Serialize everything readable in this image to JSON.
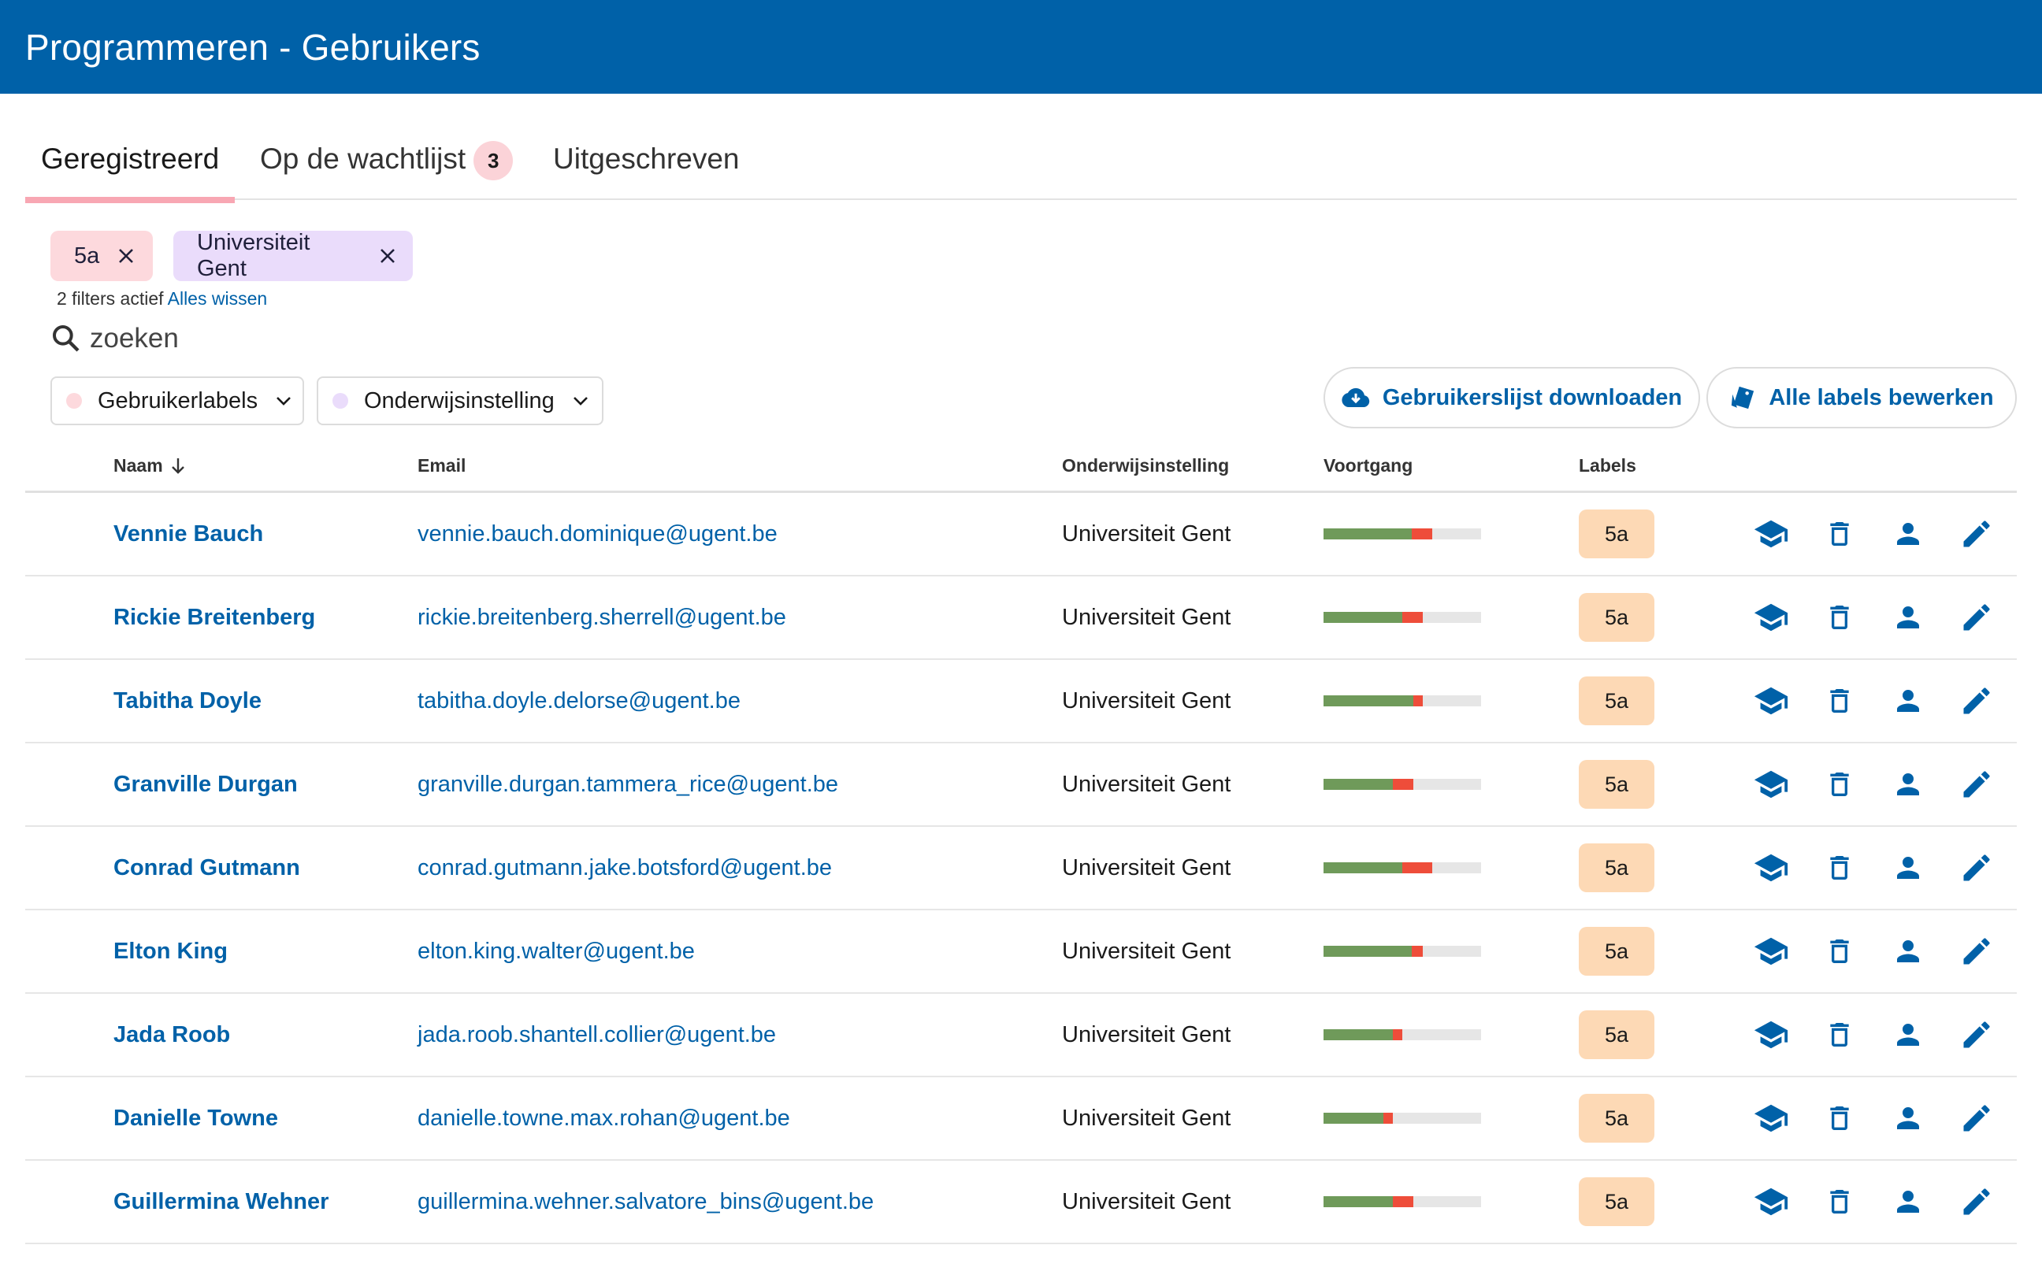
{
  "app": {
    "title": "Programmeren - Gebruikers"
  },
  "tabs": [
    {
      "label": "Geregistreerd",
      "active": true
    },
    {
      "label": "Op de wachtlijst",
      "badge": "3"
    },
    {
      "label": "Uitgeschreven"
    }
  ],
  "chips": [
    {
      "label": "5a",
      "color": "#fdd9dd"
    },
    {
      "label": "Universiteit Gent",
      "color": "#eadcfb"
    }
  ],
  "filter_info": {
    "text": "2 filters actief",
    "clear_label": "Alles wissen"
  },
  "search": {
    "placeholder": "zoeken",
    "value": ""
  },
  "dropdowns": [
    {
      "label": "Gebruikerlabels",
      "dot_color": "#fdd9dd"
    },
    {
      "label": "Onderwijsinstelling",
      "dot_color": "#eadcfb"
    }
  ],
  "buttons": {
    "download_label": "Gebruikerslijst downloaden",
    "edit_labels_label": "Alle labels bewerken"
  },
  "table": {
    "headers": {
      "name": "Naam",
      "email": "Email",
      "institution": "Onderwijsinstelling",
      "progress": "Voortgang",
      "labels": "Labels"
    },
    "sort": {
      "column": "name",
      "direction": "descending",
      "icon": "arrow-down-icon"
    },
    "rows": [
      {
        "name": "Vennie Bauch",
        "email": "vennie.bauch.dominique@ugent.be",
        "institution": "Universiteit Gent",
        "progress_ok": 0.56,
        "progress_bad": 0.13,
        "label": "5a"
      },
      {
        "name": "Rickie Breitenberg",
        "email": "rickie.breitenberg.sherrell@ugent.be",
        "institution": "Universiteit Gent",
        "progress_ok": 0.5,
        "progress_bad": 0.13,
        "label": "5a"
      },
      {
        "name": "Tabitha Doyle",
        "email": "tabitha.doyle.delorse@ugent.be",
        "institution": "Universiteit Gent",
        "progress_ok": 0.57,
        "progress_bad": 0.06,
        "label": "5a"
      },
      {
        "name": "Granville Durgan",
        "email": "granville.durgan.tammera_rice@ugent.be",
        "institution": "Universiteit Gent",
        "progress_ok": 0.44,
        "progress_bad": 0.13,
        "label": "5a"
      },
      {
        "name": "Conrad Gutmann",
        "email": "conrad.gutmann.jake.botsford@ugent.be",
        "institution": "Universiteit Gent",
        "progress_ok": 0.5,
        "progress_bad": 0.19,
        "label": "5a"
      },
      {
        "name": "Elton King",
        "email": "elton.king.walter@ugent.be",
        "institution": "Universiteit Gent",
        "progress_ok": 0.56,
        "progress_bad": 0.07,
        "label": "5a"
      },
      {
        "name": "Jada Roob",
        "email": "jada.roob.shantell.collier@ugent.be",
        "institution": "Universiteit Gent",
        "progress_ok": 0.44,
        "progress_bad": 0.06,
        "label": "5a"
      },
      {
        "name": "Danielle Towne",
        "email": "danielle.towne.max.rohan@ugent.be",
        "institution": "Universiteit Gent",
        "progress_ok": 0.38,
        "progress_bad": 0.06,
        "label": "5a"
      },
      {
        "name": "Guillermina Wehner",
        "email": "guillermina.wehner.salvatore_bins@ugent.be",
        "institution": "Universiteit Gent",
        "progress_ok": 0.44,
        "progress_bad": 0.13,
        "label": "5a"
      }
    ],
    "row_actions": [
      "graduation-cap-icon",
      "trash-icon",
      "person-icon",
      "pencil-icon"
    ]
  },
  "colors": {
    "primary": "#0061a8",
    "progress_ok": "#6f9a5a",
    "progress_bad": "#ee4d3a",
    "label_chip": "#fdd9b5",
    "tab_underline": "#f8a7b3"
  }
}
